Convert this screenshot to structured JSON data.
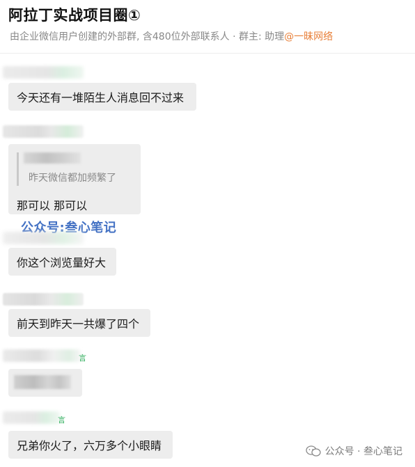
{
  "header": {
    "title": "阿拉丁实战项目圈①",
    "subtitle_prefix": "由企业微信用户创建的外部群, 含480位外部联系人 · 群主: 助理",
    "owner": "@一昧网络"
  },
  "messages": [
    {
      "text": "今天还有一堆陌生人消息回不过来"
    },
    {
      "quote": "昨天微信都加频繁了",
      "text": "那可以 那可以"
    },
    {
      "text": "你这个浏览量好大"
    },
    {
      "text": "前天到昨天一共爆了四个"
    },
    {
      "text": "兄弟你火了，六万多个小眼睛"
    }
  ],
  "watermark": {
    "overlay": "公众号:叁心笔记",
    "footer": "公众号 · 叁心笔记"
  },
  "colors": {
    "bubble": "#ededed",
    "owner_link": "#e8803a",
    "watermark": "#4472c4"
  }
}
